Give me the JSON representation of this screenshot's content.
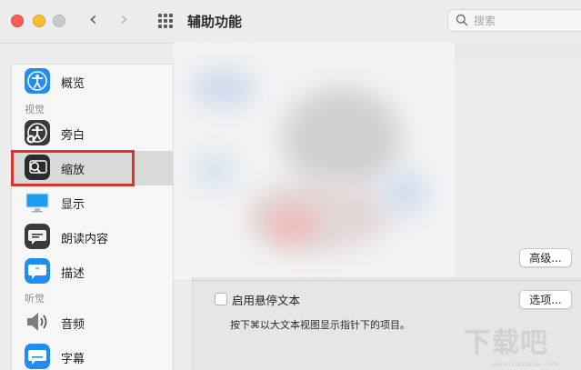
{
  "window": {
    "title": "辅助功能",
    "search_placeholder": "搜索"
  },
  "titlebar_icons": {
    "close": "close-button",
    "minimize": "minimize-button",
    "maximize": "zoom-button",
    "back": "‹",
    "forward": "›",
    "grid": "show-all-grid-icon",
    "search": "magnifier-icon"
  },
  "sidebar": {
    "top_items": [
      {
        "label": "概览",
        "icon": "accessibility-overview-icon"
      }
    ],
    "sections": [
      {
        "label": "视觉",
        "items": [
          {
            "label": "旁白",
            "icon": "voiceover-icon"
          },
          {
            "label": "缩放",
            "icon": "zoom-icon",
            "selected": true
          },
          {
            "label": "显示",
            "icon": "display-icon"
          },
          {
            "label": "朗读内容",
            "icon": "spoken-content-icon"
          },
          {
            "label": "描述",
            "icon": "descriptions-icon"
          }
        ]
      },
      {
        "label": "听觉",
        "items": [
          {
            "label": "音频",
            "icon": "audio-speaker-icon"
          },
          {
            "label": "字幕",
            "icon": "captions-icon"
          }
        ]
      }
    ]
  },
  "content": {
    "advanced_button": "高级...",
    "hover_text": {
      "checkbox_label": "启用悬停文本",
      "checked": false,
      "options_button": "选项...",
      "description": "按下⌘以大文本视图显示指针下的项目。"
    }
  },
  "colors": {
    "highlight_box": "#d9342b",
    "selected_row": "#d9d9d9",
    "accent_blue": "#1f8df2"
  },
  "watermark": {
    "text": "下载吧",
    "url": "www.xiazaiba.com"
  }
}
